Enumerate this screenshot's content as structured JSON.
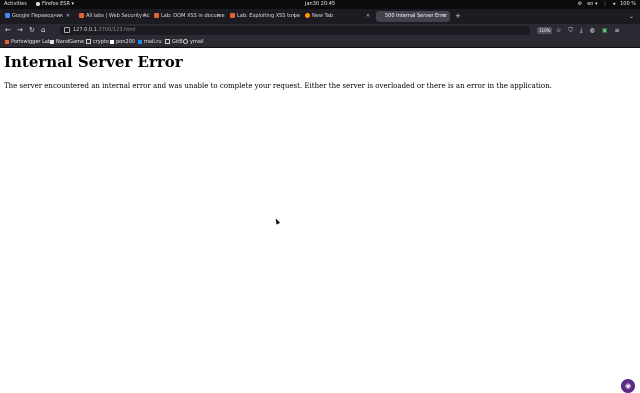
{
  "topbar": {
    "activities": "Activities",
    "app_name": "Firefox ESR ▾",
    "clock": "Jan30  20:45",
    "lang": "en ▾",
    "battery": "100 %"
  },
  "tabs": [
    {
      "label": "Google Переводчик",
      "favicon_color": "#4285f4"
    },
    {
      "label": "All labs | Web Security Ac",
      "favicon_color": "#e8632b"
    },
    {
      "label": "Lab: DOM XSS in docume",
      "favicon_color": "#e8632b"
    },
    {
      "label": "Lab: Exploiting XSS to pe",
      "favicon_color": "#e8632b"
    },
    {
      "label": "New Tab",
      "favicon_color": "#ff9500"
    },
    {
      "label": "500 Internal Server Error",
      "favicon_color": ""
    }
  ],
  "navbar": {
    "url_host": "127.0.0.1",
    "url_path": ":3700/123.html",
    "zoom": "110%"
  },
  "bookmarks": [
    {
      "label": "Portswigger Lab",
      "icon": "portswigger-icon",
      "color": "#e8632b"
    },
    {
      "label": "NandGame",
      "icon": "nandgame-icon",
      "color": "#dddddd"
    },
    {
      "label": "crypto",
      "icon": "folder-icon",
      "color": "#cfcfcf"
    },
    {
      "label": "pon200",
      "icon": "pon-icon",
      "color": "#ffffff"
    },
    {
      "label": "mail.ru",
      "icon": "mail-icon",
      "color": "#168de2"
    },
    {
      "label": "GitB",
      "icon": "folder-icon",
      "color": "#cfcfcf"
    },
    {
      "label": "ymail",
      "icon": "ymail-icon",
      "color": "#cccccc"
    }
  ],
  "page": {
    "heading": "Internal Server Error",
    "message": "The server encountered an internal error and was unable to complete your request. Either the server is overloaded or there is an error in the application."
  }
}
